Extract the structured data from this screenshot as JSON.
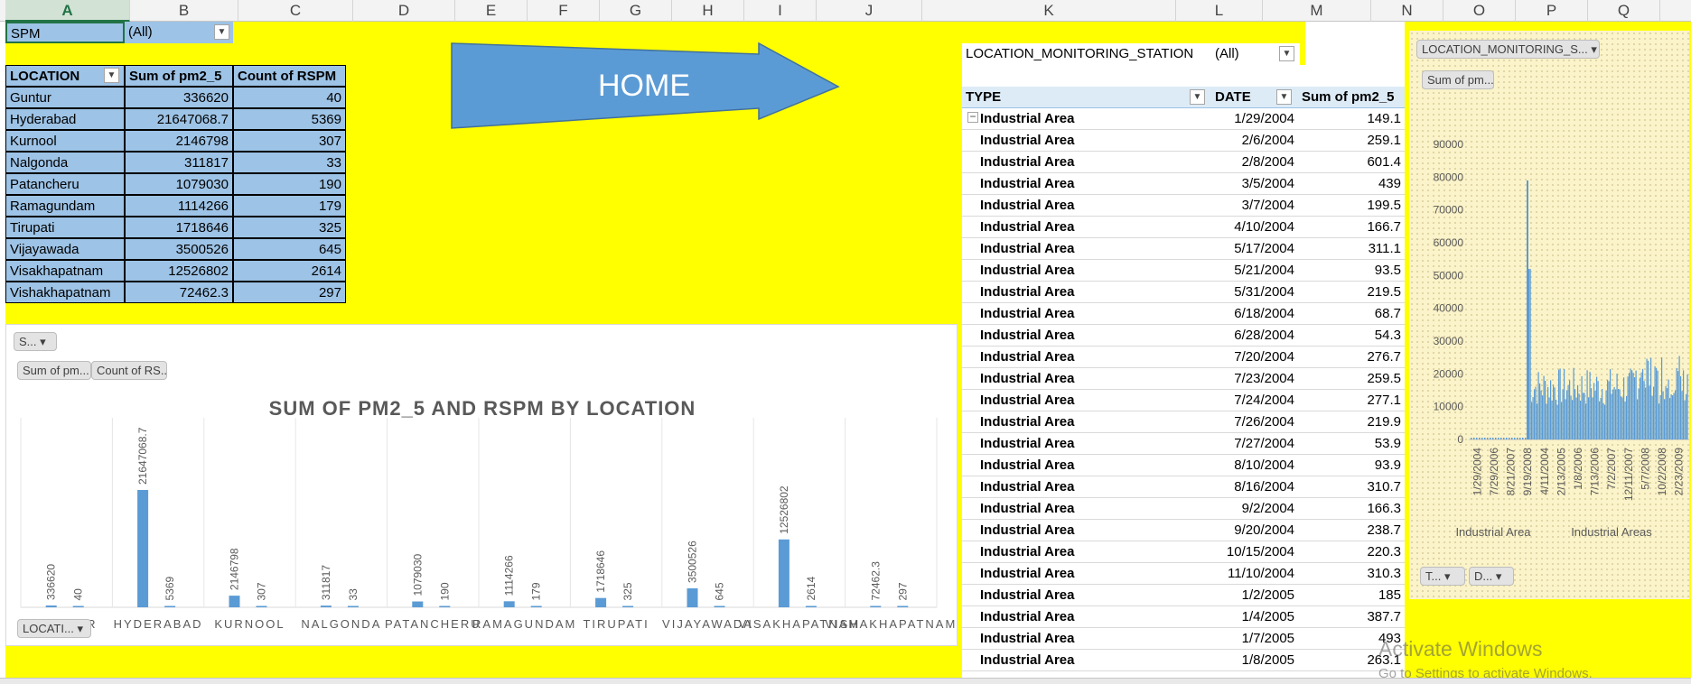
{
  "columns": [
    "A",
    "B",
    "C",
    "D",
    "E",
    "F",
    "G",
    "H",
    "I",
    "J",
    "K",
    "L",
    "M",
    "N",
    "O",
    "P",
    "Q"
  ],
  "filter": {
    "label": "SPM",
    "value": "(All)"
  },
  "left_pivot": {
    "headers": [
      "LOCATION",
      "Sum of pm2_5",
      "Count of RSPM"
    ],
    "rows": [
      [
        "Guntur",
        "336620",
        "40"
      ],
      [
        "Hyderabad",
        "21647068.7",
        "5369"
      ],
      [
        "Kurnool",
        "2146798",
        "307"
      ],
      [
        "Nalgonda",
        "311817",
        "33"
      ],
      [
        "Patancheru",
        "1079030",
        "190"
      ],
      [
        "Ramagundam",
        "1114266",
        "179"
      ],
      [
        "Tirupati",
        "1718646",
        "325"
      ],
      [
        "Vijayawada",
        "3500526",
        "645"
      ],
      [
        "Visakhapatnam",
        "12526802",
        "2614"
      ],
      [
        "Vishakhapatnam",
        "72462.3",
        "297"
      ]
    ]
  },
  "home_button": {
    "label": "HOME"
  },
  "right_filter": {
    "label": "LOCATION_MONITORING_STATION",
    "value": "(All)"
  },
  "right_pivot": {
    "headers": [
      "TYPE",
      "DATE",
      "Sum of pm2_5"
    ],
    "rows": [
      [
        "Industrial Area",
        "1/29/2004",
        "149.1"
      ],
      [
        "Industrial Area",
        "2/6/2004",
        "259.1"
      ],
      [
        "Industrial Area",
        "2/8/2004",
        "601.4"
      ],
      [
        "Industrial Area",
        "3/5/2004",
        "439"
      ],
      [
        "Industrial Area",
        "3/7/2004",
        "199.5"
      ],
      [
        "Industrial Area",
        "4/10/2004",
        "166.7"
      ],
      [
        "Industrial Area",
        "5/17/2004",
        "311.1"
      ],
      [
        "Industrial Area",
        "5/21/2004",
        "93.5"
      ],
      [
        "Industrial Area",
        "5/31/2004",
        "219.5"
      ],
      [
        "Industrial Area",
        "6/18/2004",
        "68.7"
      ],
      [
        "Industrial Area",
        "6/28/2004",
        "54.3"
      ],
      [
        "Industrial Area",
        "7/20/2004",
        "276.7"
      ],
      [
        "Industrial Area",
        "7/23/2004",
        "259.5"
      ],
      [
        "Industrial Area",
        "7/24/2004",
        "277.1"
      ],
      [
        "Industrial Area",
        "7/26/2004",
        "219.9"
      ],
      [
        "Industrial Area",
        "7/27/2004",
        "53.9"
      ],
      [
        "Industrial Area",
        "8/10/2004",
        "93.9"
      ],
      [
        "Industrial Area",
        "8/16/2004",
        "310.7"
      ],
      [
        "Industrial Area",
        "9/2/2004",
        "166.3"
      ],
      [
        "Industrial Area",
        "9/20/2004",
        "238.7"
      ],
      [
        "Industrial Area",
        "10/15/2004",
        "220.3"
      ],
      [
        "Industrial Area",
        "11/10/2004",
        "310.3"
      ],
      [
        "Industrial Area",
        "1/2/2005",
        "185"
      ],
      [
        "Industrial Area",
        "1/4/2005",
        "387.7"
      ],
      [
        "Industrial Area",
        "1/7/2005",
        "493"
      ],
      [
        "Industrial Area",
        "1/8/2005",
        "263.1"
      ]
    ]
  },
  "chart_buttons": {
    "series_filter": "S...",
    "sum_field": "Sum of pm...",
    "count_field": "Count of RS...",
    "location_field": "LOCATI..."
  },
  "right_chart_buttons": {
    "station": "LOCATION_MONITORING_S...",
    "sum": "Sum of pm...",
    "type": "T...",
    "date": "D..."
  },
  "watermark": {
    "title": "Activate Windows",
    "subtitle": "Go to Settings to activate Windows."
  },
  "chart_data": [
    {
      "type": "bar",
      "title": "SUM OF PM2_5 AND RSPM BY LOCATION",
      "categories": [
        "GUNTUR",
        "HYDERABAD",
        "KURNOOL",
        "NALGONDA",
        "PATANCHERU",
        "RAMAGUNDAM",
        "TIRUPATI",
        "VIJAYAWADA",
        "VISAKHAPATNAM",
        "VISHAKHAPATNAM"
      ],
      "series": [
        {
          "values": [
            336620,
            21647068.7,
            2146798,
            311817,
            1079030,
            1114266,
            1718646,
            3500526,
            12526802,
            72462.3
          ]
        },
        {
          "values": [
            40,
            5369,
            307,
            33,
            190,
            179,
            325,
            645,
            2614,
            297
          ]
        }
      ],
      "value_labels": [
        [
          "336620",
          "21647068.7",
          "2146798",
          "311817",
          "1079030",
          "1114266",
          "1718646",
          "3500526",
          "12526802",
          "72462.3"
        ],
        [
          "40",
          "5369",
          "307",
          "33",
          "190",
          "179",
          "325",
          "645",
          "2614",
          "297"
        ]
      ],
      "color": "#5b9bd5",
      "ylim": [
        0,
        21647068.7
      ],
      "grid": false,
      "legend": "none"
    },
    {
      "type": "bar",
      "title": "",
      "ylim": [
        0,
        90000
      ],
      "yticks": [
        "0",
        "10000",
        "20000",
        "30000",
        "40000",
        "50000",
        "60000",
        "70000",
        "80000",
        "90000"
      ],
      "xticks": [
        "1/29/2004",
        "7/29/2006",
        "8/21/2007",
        "9/19/2008",
        "4/11/2004",
        "2/13/2005",
        "1/8/2006",
        "7/13/2006",
        "7/2/2007",
        "12/11/2007",
        "5/7/2008",
        "10/2/2008",
        "2/23/2009"
      ],
      "groups": [
        "Industrial Area",
        "Industrial Areas"
      ],
      "color": "#5b9bd5",
      "spike": 79000,
      "grid": false,
      "legend": "none"
    }
  ]
}
